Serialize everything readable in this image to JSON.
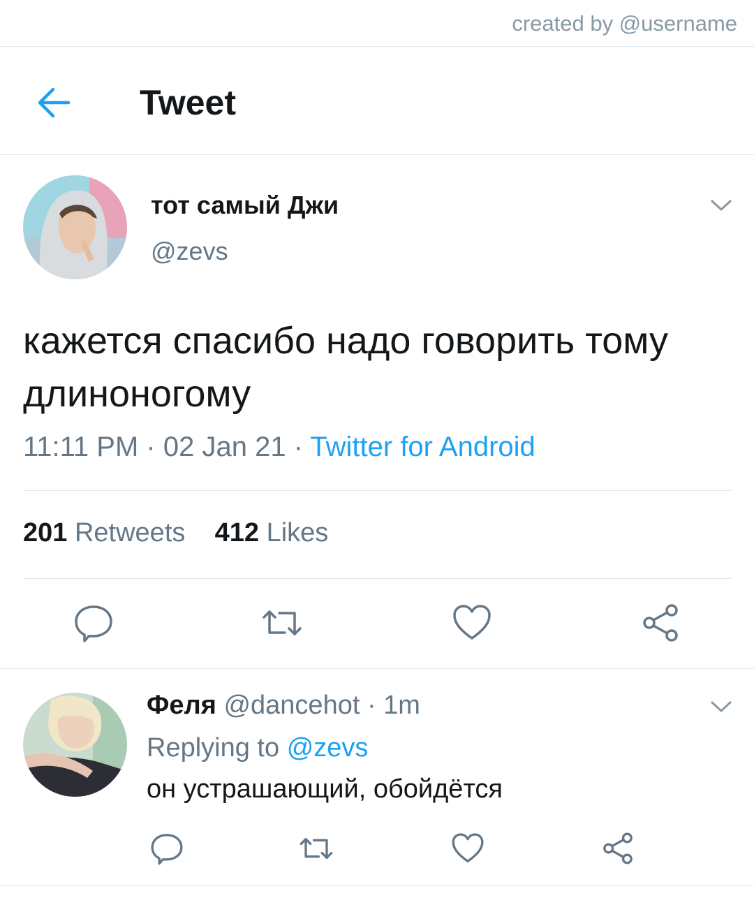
{
  "credit": "created by @username",
  "header": {
    "title": "Tweet",
    "back_icon": "arrow-left-icon"
  },
  "tweet": {
    "display_name": "тот самый Джи",
    "handle": "@zevs",
    "text": "кажется спасибо надо говорить тому длиноногому",
    "time": "11:11 PM",
    "date": "02 Jan 21",
    "separator": "·",
    "source": "Twitter for Android",
    "retweets_count": "201",
    "retweets_label": "Retweets",
    "likes_count": "412",
    "likes_label": "Likes",
    "actions": [
      "reply-icon",
      "retweet-icon",
      "heart-icon",
      "share-icon"
    ]
  },
  "reply": {
    "display_name": "Феля",
    "handle": "@dancehot",
    "separator": "·",
    "time": "1m",
    "replying_prefix": "Replying to",
    "replying_to": "@zevs",
    "text": "он устрашающий, обойдётся",
    "actions": [
      "reply-icon",
      "retweet-icon",
      "heart-icon",
      "share-icon"
    ]
  },
  "colors": {
    "accent": "#1da1f2",
    "muted": "#657786",
    "divider": "#e1e8ed",
    "text": "#14171a"
  }
}
